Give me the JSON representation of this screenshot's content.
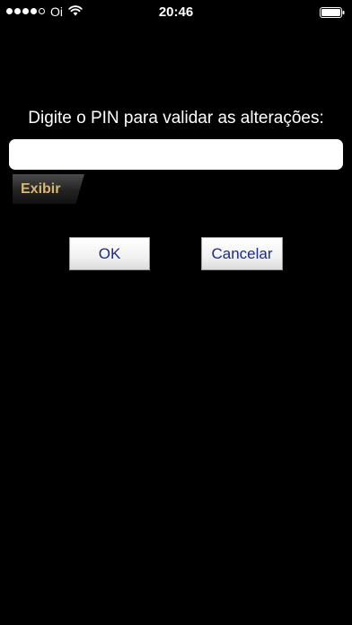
{
  "status_bar": {
    "carrier": "Oi",
    "time": "20:46",
    "signal_bars": 4,
    "signal_max": 5
  },
  "dialog": {
    "prompt": "Digite o PIN para validar as alterações:",
    "pin_value": "",
    "show_label": "Exibir",
    "ok_label": "OK",
    "cancel_label": "Cancelar"
  },
  "colors": {
    "background": "#000000",
    "button_text": "#1b2a8c",
    "show_text": "#d8b870"
  }
}
